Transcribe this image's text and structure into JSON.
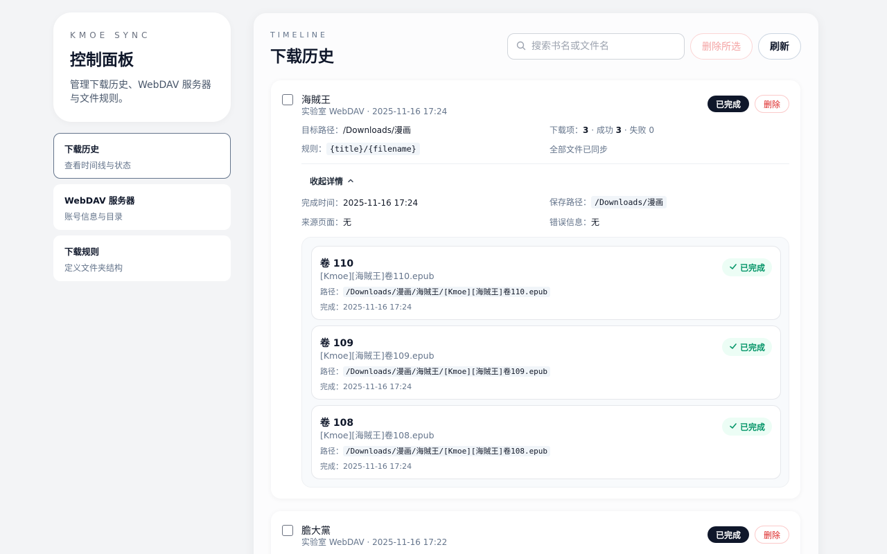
{
  "sidebar": {
    "eyebrow": "KMOE SYNC",
    "title": "控制面板",
    "description": "管理下载历史、WebDAV 服务器与文件规则。",
    "items": [
      {
        "title": "下载历史",
        "subtitle": "查看时间线与状态",
        "active": true
      },
      {
        "title": "WebDAV 服务器",
        "subtitle": "账号信息与目录",
        "active": false
      },
      {
        "title": "下载规则",
        "subtitle": "定义文件夹结构",
        "active": false
      }
    ]
  },
  "header": {
    "eyebrow": "TIMELINE",
    "title": "下载历史",
    "search_placeholder": "搜索书名或文件名",
    "delete_selected_label": "删除所选",
    "refresh_label": "刷新"
  },
  "entries": [
    {
      "title": "海賊王",
      "subtitle": "实验室 WebDAV · 2025-11-16 17:24",
      "status": "已完成",
      "delete_label": "删除",
      "target_label": "目标路径：",
      "target_path": "/Downloads/漫画",
      "rule_label": "规则：",
      "rule": "{title}/{filename}",
      "stats": {
        "label": "下载项：",
        "total": "3",
        "success_label": "成功",
        "success": "3",
        "fail_label": "失败",
        "fail": "0"
      },
      "sync_status": "全部文件已同步",
      "collapse_label": "收起详情",
      "completed_label": "完成时间：",
      "completed_at": "2025-11-16 17:24",
      "save_path_label": "保存路径：",
      "save_path": "/Downloads/漫画",
      "source_label": "来源页面：",
      "source": "无",
      "error_label": "错误信息：",
      "error": "无",
      "volumes": [
        {
          "title": "卷 110",
          "file": "[Kmoe][海賊王]卷110.epub",
          "path_label": "路径：",
          "path": "/Downloads/漫画/海賊王/[Kmoe][海賊王]卷110.epub",
          "time_label": "完成：",
          "time": "2025-11-16 17:24",
          "status": "已完成"
        },
        {
          "title": "卷 109",
          "file": "[Kmoe][海賊王]卷109.epub",
          "path_label": "路径：",
          "path": "/Downloads/漫画/海賊王/[Kmoe][海賊王]卷109.epub",
          "time_label": "完成：",
          "time": "2025-11-16 17:24",
          "status": "已完成"
        },
        {
          "title": "卷 108",
          "file": "[Kmoe][海賊王]卷108.epub",
          "path_label": "路径：",
          "path": "/Downloads/漫画/海賊王/[Kmoe][海賊王]卷108.epub",
          "time_label": "完成：",
          "time": "2025-11-16 17:24",
          "status": "已完成"
        }
      ]
    },
    {
      "title": "膽大黨",
      "subtitle": "实验室 WebDAV · 2025-11-16 17:22",
      "status": "已完成",
      "delete_label": "删除"
    }
  ],
  "colors": {
    "accent_dark": "#0f172a",
    "danger": "#dc2626",
    "success": "#059669",
    "success_bg": "#ecfdf5"
  }
}
